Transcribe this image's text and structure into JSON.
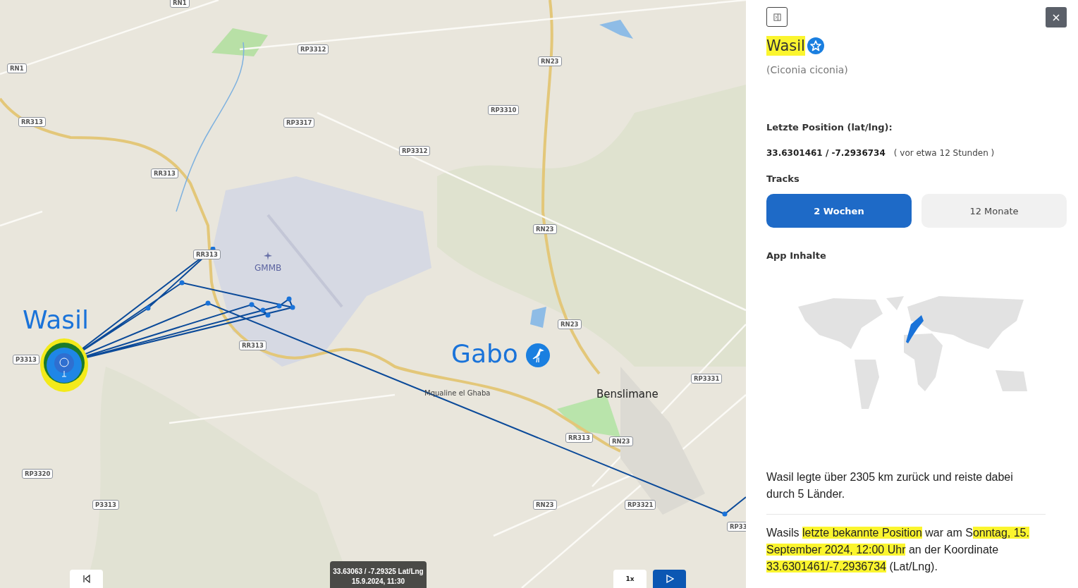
{
  "map": {
    "road_labels": [
      "RN1",
      "RP3312",
      "RN1",
      "RR313",
      "RP3317",
      "RP3310",
      "RP3312",
      "RN23",
      "RR313",
      "RR313",
      "RN23",
      "RN23",
      "RR313",
      "P3313",
      "RP3331",
      "RR313",
      "RN23",
      "RP3320",
      "P3313",
      "RN23",
      "RP3321",
      "RP33"
    ],
    "place_labels": [
      {
        "text": "GMMB",
        "kind": "airport"
      },
      {
        "text": "Mqualine el Ghaba",
        "kind": "locality"
      },
      {
        "text": "Benslimane",
        "kind": "town"
      }
    ],
    "animals": [
      {
        "name": "Wasil",
        "kind": "selected"
      },
      {
        "name": "Gabo",
        "kind": "stork"
      }
    ]
  },
  "playback": {
    "tooltip_coords": "33.63063 / -7.29325 Lat/Lng",
    "tooltip_time": "15.9.2024, 11:30",
    "speed": "1x"
  },
  "panel": {
    "title": {
      "text": "Wasil",
      "highlighted": true
    },
    "species": "(Ciconia ciconia)",
    "position_label": "Letzte Position (lat/lng):",
    "position": "33.6301461 / -7.2936734",
    "position_age": "( vor etwa 12 Stunden )",
    "tracks_label": "Tracks",
    "tracks": [
      {
        "label": "2 Wochen",
        "selected": true
      },
      {
        "label": "12 Monate",
        "selected": false
      }
    ],
    "content_label": "App Inhalte",
    "summary": "Wasil legte über 2305 km zurück und reiste dabei durch 5 Länder.",
    "last_position": [
      {
        "text": "Wasils ",
        "highlighted": false
      },
      {
        "text": "letzte bekannte Position",
        "highlighted": true
      },
      {
        "text": " war am S",
        "highlighted": false
      },
      {
        "text": "onntag, 15. September 2024, 12:00 Uhr",
        "highlighted": true
      },
      {
        "text": " an der Koordinate ",
        "highlighted": false
      },
      {
        "text": "33.6301461/-7.2936734",
        "highlighted": true
      },
      {
        "text": " (Lat/Lng).",
        "highlighted": false
      }
    ]
  }
}
